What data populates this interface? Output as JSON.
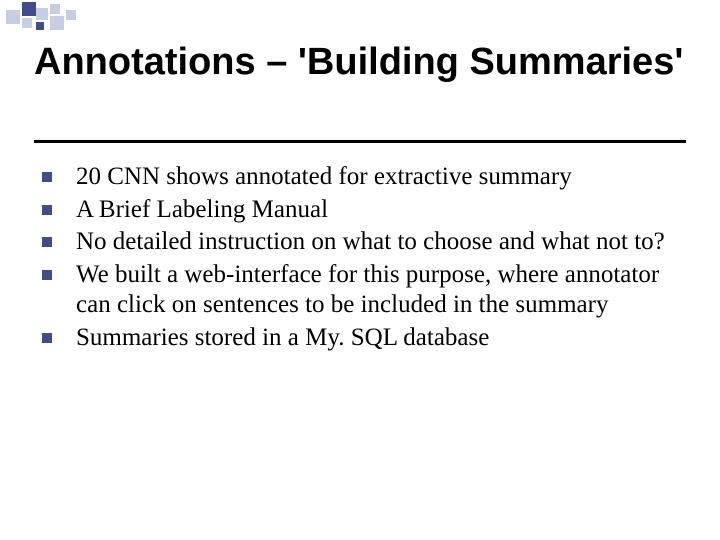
{
  "title": "Annotations – 'Building Summaries'",
  "bullets": [
    "20 CNN shows annotated for extractive summary",
    "A Brief Labeling Manual",
    "No detailed instruction on what to choose and what not to?",
    "We built a web-interface for this purpose, where annotator can click on sentences to be included in the summary",
    "Summaries stored in a My. SQL database"
  ]
}
